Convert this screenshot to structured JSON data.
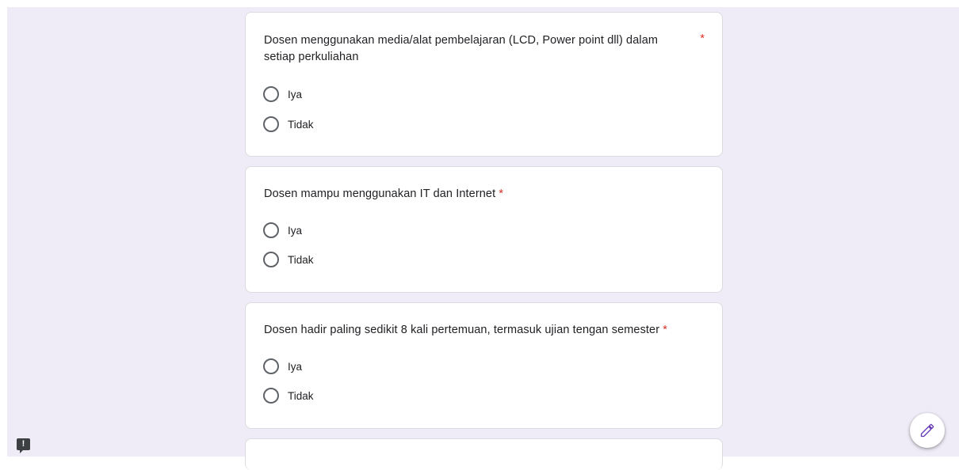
{
  "questions": [
    {
      "title_line1": "Dosen menggunakan media/alat pembelajaran (LCD, Power point dll) dalam",
      "title_line2": "setiap perkuliahan",
      "required_mark": "*",
      "options": [
        "Iya",
        "Tidak"
      ]
    },
    {
      "title": "Dosen mampu menggunakan IT dan Internet",
      "required_mark": "*",
      "options": [
        "Iya",
        "Tidak"
      ]
    },
    {
      "title": "Dosen hadir paling sedikit 8 kali pertemuan, termasuk ujian tengan semester",
      "required_mark": "*",
      "options": [
        "Iya",
        "Tidak"
      ]
    }
  ],
  "feedback_button": {
    "icon": "report-icon",
    "glyph": "!"
  },
  "edit_button": {
    "icon": "pencil-icon"
  },
  "colors": {
    "accent": "#673ab7",
    "required": "#d93025",
    "background": "#efebf7"
  }
}
